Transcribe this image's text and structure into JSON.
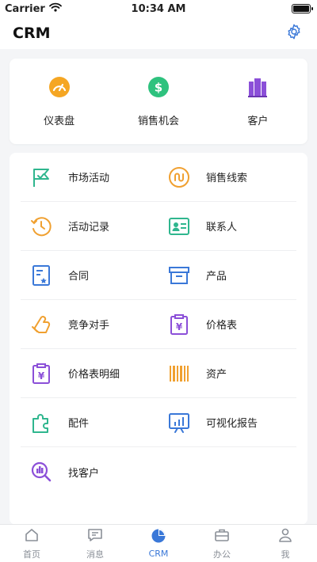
{
  "status": {
    "carrier": "Carrier",
    "time": "10:34 AM"
  },
  "header": {
    "title": "CRM"
  },
  "quick": [
    {
      "label": "仪表盘",
      "icon": "dashboard-icon",
      "color": "#f5a623"
    },
    {
      "label": "销售机会",
      "icon": "dollar-icon",
      "color": "#2ec27e"
    },
    {
      "label": "客户",
      "icon": "buildings-icon",
      "color": "#8b4fd8"
    }
  ],
  "modules": [
    {
      "label": "市场活动",
      "icon": "flag-icon",
      "color": "#2fb68e"
    },
    {
      "label": "销售线索",
      "icon": "lead-icon",
      "color": "#f0a030"
    },
    {
      "label": "活动记录",
      "icon": "history-icon",
      "color": "#f0a030"
    },
    {
      "label": "联系人",
      "icon": "contact-card-icon",
      "color": "#2fb68e"
    },
    {
      "label": "合同",
      "icon": "contract-icon",
      "color": "#3a78d8"
    },
    {
      "label": "产品",
      "icon": "product-box-icon",
      "color": "#3a78d8"
    },
    {
      "label": "竞争对手",
      "icon": "competitor-icon",
      "color": "#f0a030"
    },
    {
      "label": "价格表",
      "icon": "price-list-icon",
      "color": "#8b4fd8"
    },
    {
      "label": "价格表明细",
      "icon": "price-detail-icon",
      "color": "#8b4fd8"
    },
    {
      "label": "资产",
      "icon": "barcode-icon",
      "color": "#f0a030"
    },
    {
      "label": "配件",
      "icon": "puzzle-icon",
      "color": "#2fb68e"
    },
    {
      "label": "可视化报告",
      "icon": "report-chart-icon",
      "color": "#3a78d8"
    },
    {
      "label": "找客户",
      "icon": "find-customer-icon",
      "color": "#8b4fd8"
    }
  ],
  "tabs": [
    {
      "label": "首页",
      "icon": "home-icon"
    },
    {
      "label": "消息",
      "icon": "message-icon"
    },
    {
      "label": "CRM",
      "icon": "pie-chart-icon",
      "active": true
    },
    {
      "label": "办公",
      "icon": "briefcase-icon"
    },
    {
      "label": "我",
      "icon": "person-icon"
    }
  ],
  "colors": {
    "accent": "#3a78d8",
    "inactive": "#8a8f97"
  }
}
